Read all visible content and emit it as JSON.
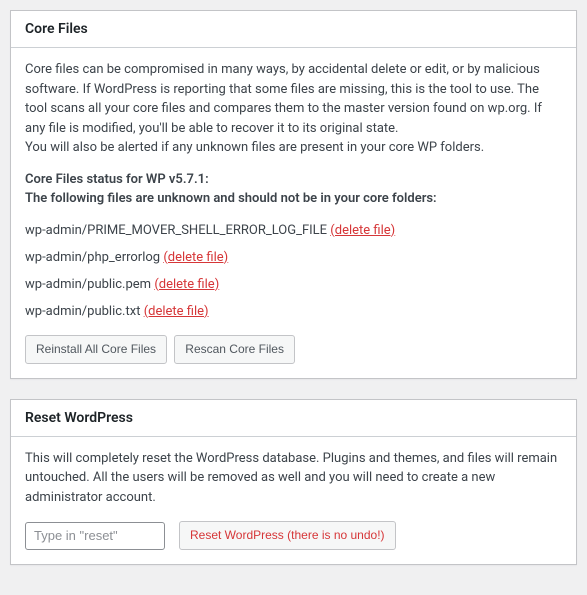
{
  "coreFiles": {
    "title": "Core Files",
    "intro": "Core files can be compromised in many ways, by accidental delete or edit, or by malicious software. If WordPress is reporting that some files are missing, this is the tool to use. The tool scans all your core files and compares them to the master version found on wp.org. If any file is modified, you'll be able to recover it to its original state.",
    "alertNote": "You will also be alerted if any unknown files are present in your core WP folders.",
    "statusHeading": "Core Files status for WP v5.7.1:",
    "statusSubheading": "The following files are unknown and should not be in your core folders:",
    "files": [
      {
        "path": "wp-admin/PRIME_MOVER_SHELL_ERROR_LOG_FILE",
        "action": "(delete file)"
      },
      {
        "path": "wp-admin/php_errorlog",
        "action": "(delete file)"
      },
      {
        "path": "wp-admin/public.pem",
        "action": "(delete file)"
      },
      {
        "path": "wp-admin/public.txt",
        "action": "(delete file)"
      }
    ],
    "reinstallBtn": "Reinstall All Core Files",
    "rescanBtn": "Rescan Core Files"
  },
  "resetWp": {
    "title": "Reset WordPress",
    "description": "This will completely reset the WordPress database. Plugins and themes, and files will remain untouched. All the users will be removed as well and you will need to create a new administrator account.",
    "inputPlaceholder": "Type in \"reset\"",
    "resetBtn": "Reset WordPress (there is no undo!)"
  }
}
